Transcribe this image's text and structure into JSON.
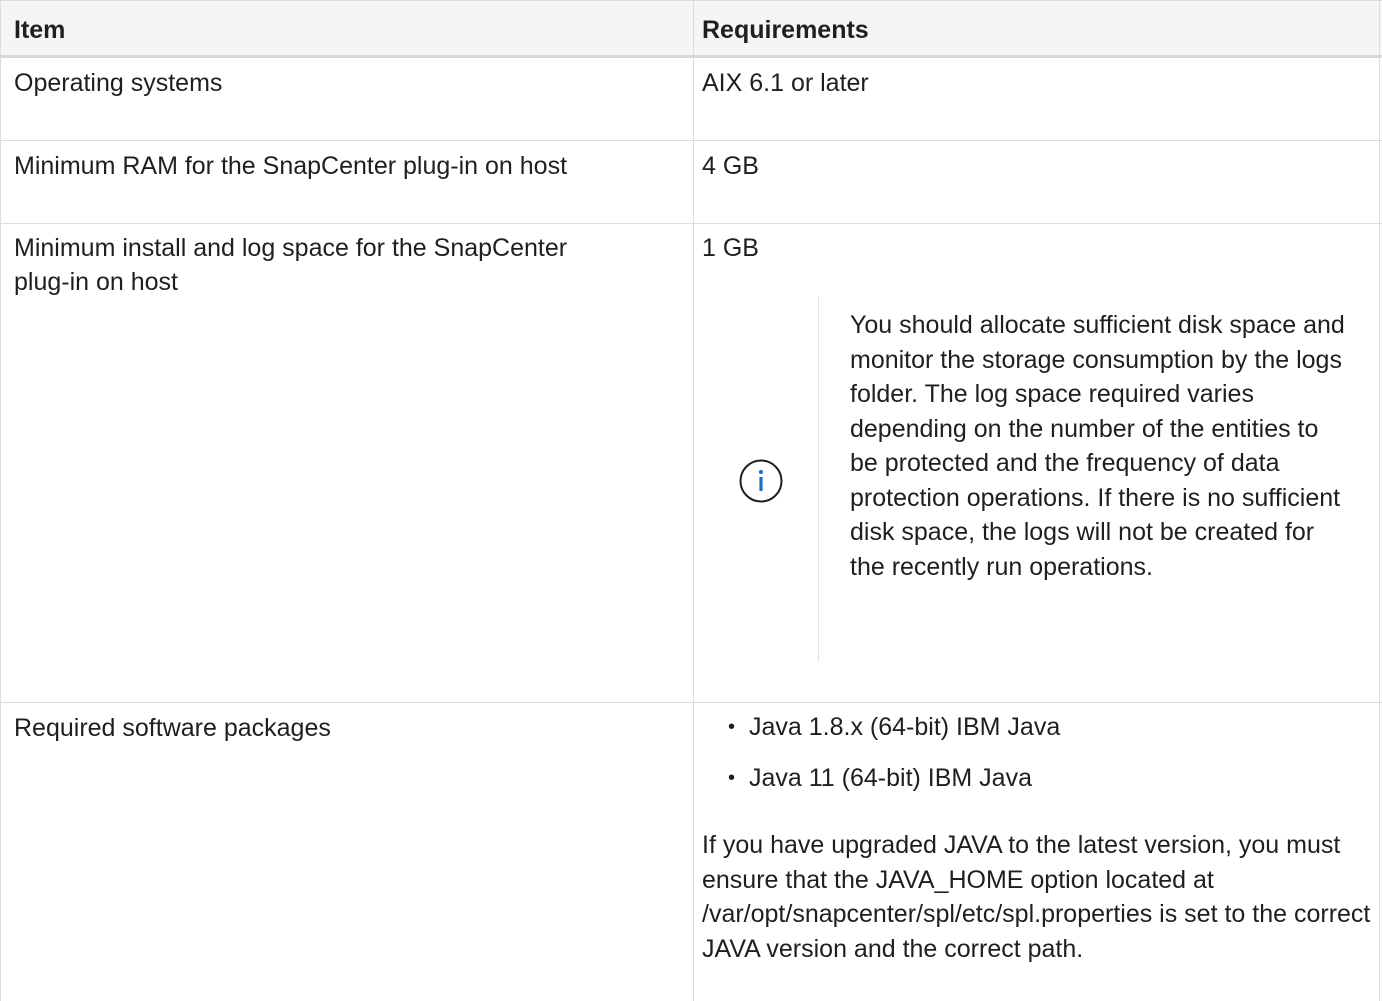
{
  "table": {
    "headers": {
      "item": "Item",
      "requirements": "Requirements"
    },
    "rows": [
      {
        "item": "Operating systems",
        "requirement": "AIX 6.1 or later"
      },
      {
        "item": "Minimum RAM for the SnapCenter plug-in on host",
        "requirement": "4 GB"
      },
      {
        "item_line1": "Minimum install and log space for the SnapCenter",
        "item_line2": "plug-in on host",
        "requirement": "1 GB",
        "note": "You should allocate sufficient disk space and monitor the storage consumption by the logs folder. The log space required varies depending on the number of the entities to be protected and the frequency of data protection operations. If there is no sufficient disk space, the logs will not be created for the recently run operations.",
        "note_icon": "info-icon"
      },
      {
        "item": "Required software packages",
        "bullets": [
          "Java 1.8.x (64-bit) IBM Java",
          "Java 11 (64-bit) IBM Java"
        ],
        "paragraph": "If you have upgraded JAVA to the latest version, you must ensure that the JAVA_HOME option located at /var/opt/snapcenter/spl/etc/spl.properties is set to the correct JAVA version and the correct path."
      }
    ]
  },
  "colors": {
    "border": "#dcdcdc",
    "header_bg": "#f5f5f5",
    "info_icon": "#1a6fc0",
    "text": "#1f1f1f"
  }
}
